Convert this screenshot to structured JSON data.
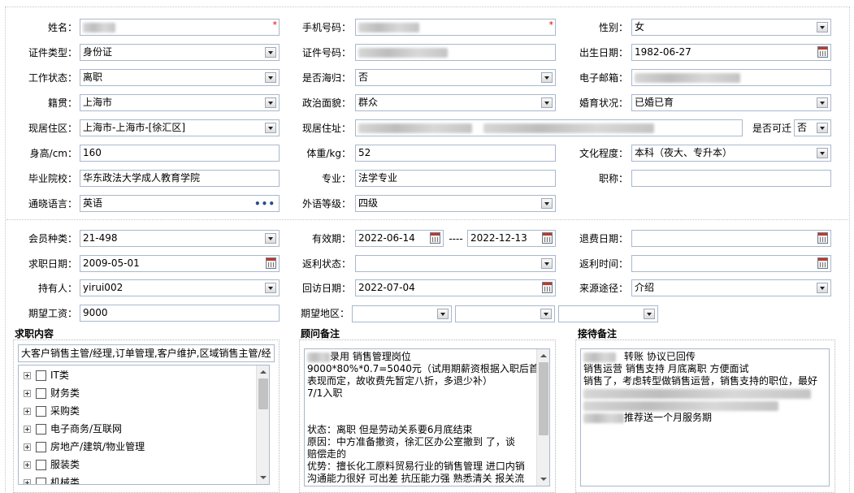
{
  "personal": {
    "name": {
      "label": "姓名：",
      "value": ""
    },
    "phone": {
      "label": "手机号码：",
      "value": ""
    },
    "gender": {
      "label": "性别：",
      "value": "女"
    },
    "id_type": {
      "label": "证件类型：",
      "value": "身份证"
    },
    "id_number": {
      "label": "证件号码：",
      "value": ""
    },
    "birth_date": {
      "label": "出生日期：",
      "value": "1982-06-27"
    },
    "work_status": {
      "label": "工作状态：",
      "value": "离职"
    },
    "overseas_returnee": {
      "label": "是否海归：",
      "value": "否"
    },
    "email": {
      "label": "电子邮箱：",
      "value": ""
    },
    "native_place": {
      "label": "籍贯：",
      "value": "上海市"
    },
    "political_status": {
      "label": "政治面貌：",
      "value": "群众"
    },
    "marital_status": {
      "label": "婚育状况：",
      "value": "已婚已育"
    },
    "current_residence": {
      "label": "现居住区：",
      "value": "上海市-上海市-[徐汇区]"
    },
    "current_address": {
      "label": "现居住址：",
      "value": ""
    },
    "relocatable": {
      "label": "是否可迁",
      "value": "否"
    },
    "height": {
      "label": "身高/cm：",
      "value": "160"
    },
    "weight": {
      "label": "体重/kg：",
      "value": "52"
    },
    "education": {
      "label": "文化程度：",
      "value": "本科（夜大、专升本）"
    },
    "school": {
      "label": "毕业院校：",
      "value": "华东政法大学成人教育学院"
    },
    "major": {
      "label": "专业：",
      "value": "法学专业"
    },
    "title": {
      "label": "职称：",
      "value": ""
    },
    "languages": {
      "label": "通晓语言：",
      "value": "英语"
    },
    "foreign_level": {
      "label": "外语等级：",
      "value": "四级"
    }
  },
  "membership": {
    "member_type": {
      "label": "会员种类：",
      "value": "21-498"
    },
    "validity": {
      "label": "有效期：",
      "start": "2022-06-14",
      "sep": "----",
      "end": "2022-12-13"
    },
    "refund_date": {
      "label": "退费日期：",
      "value": ""
    },
    "job_seek_date": {
      "label": "求职日期：",
      "value": "2009-05-01"
    },
    "rebate_status": {
      "label": "返利状态：",
      "value": ""
    },
    "rebate_time": {
      "label": "返利时间：",
      "value": ""
    },
    "holder": {
      "label": "持有人：",
      "value": "yirui002"
    },
    "followup_date": {
      "label": "回访日期：",
      "value": "2022-07-04"
    },
    "source": {
      "label": "来源途径：",
      "value": "介绍"
    },
    "expected_salary": {
      "label": "期望工资：",
      "value": "9000"
    },
    "expected_region": {
      "label": "期望地区：",
      "values": [
        "",
        "",
        ""
      ]
    }
  },
  "job_content": {
    "title": "求职内容",
    "selected": "大客户销售主管/经理,订单管理,客户维护,区域销售主管/经",
    "tree": [
      "IT类",
      "财务类",
      "采购类",
      "电子商务/互联网",
      "房地产/建筑/物业管理",
      "服装类",
      "机械类"
    ]
  },
  "consultant_notes": {
    "title": "顾问备注",
    "lines": [
      "录用 销售管理岗位",
      "9000*80%*0.7=5040元（试用期薪资根据入职后首月",
      "表现而定，故收费先暂定八折，多退少补）",
      "7/1入职",
      "",
      "",
      "状态：离职  但是劳动关系要6月底结束",
      "原因：中方准备撤资，徐汇区办公室撤到        了，谈",
      "赔偿走的",
      "优势：擅长化工原料贸易行业的销售管理 进口内销",
      "沟通能力很好 可出差 抗压能力强 熟悉清关 报关流"
    ]
  },
  "reception_notes": {
    "title": "接待备注",
    "lines": [
      "转账  协议已回传",
      "销售运营 销售支持  月底离职 方便面试",
      "销售了，考虑转型做销售运营，销售支持的职位，最好",
      "",
      "",
      "推荐送一个月服务期"
    ]
  }
}
